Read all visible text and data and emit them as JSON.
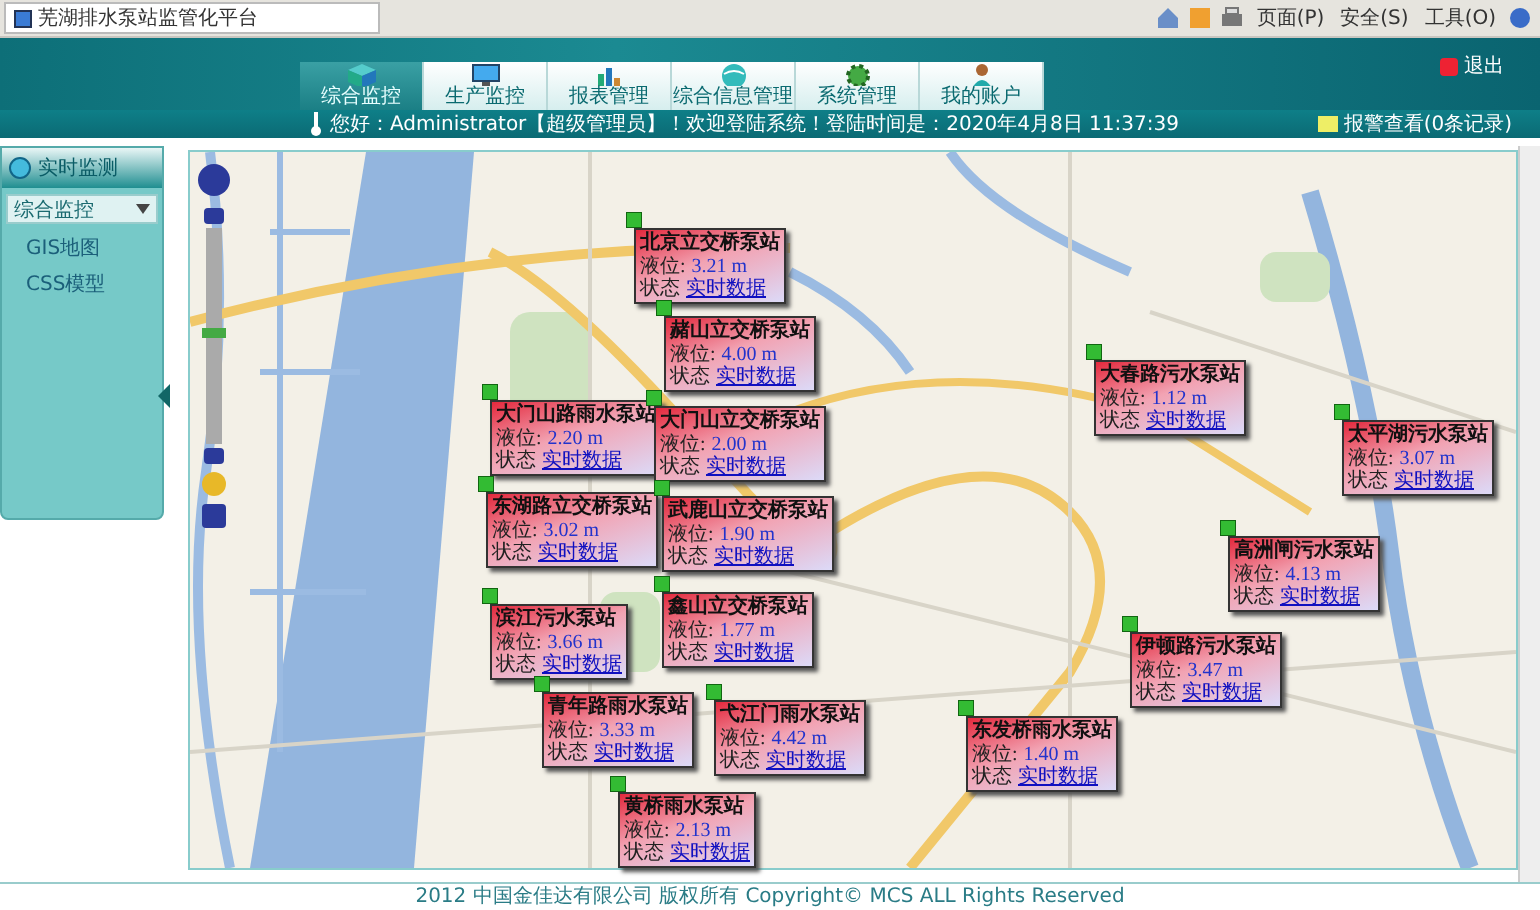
{
  "browser": {
    "tab_title": "芜湖排水泵站监管化平台",
    "toolbar": [
      "页面(P)",
      "安全(S)",
      "工具(O)"
    ]
  },
  "header": {
    "tabs": [
      {
        "label": "综合监控",
        "selected": true
      },
      {
        "label": "生产监控",
        "selected": false
      },
      {
        "label": "报表管理",
        "selected": false
      },
      {
        "label": "综合信息管理",
        "selected": false
      },
      {
        "label": "系统管理",
        "selected": false
      },
      {
        "label": "我的账户",
        "selected": false
      }
    ],
    "logout": "退出"
  },
  "info_bar": {
    "welcome": "您好：Administrator【超级管理员】！欢迎登陆系统！登陆时间是：2020年4月8日 11:37:39",
    "alarm": "报警查看(0条记录)"
  },
  "sidebar": {
    "title": "实时监测",
    "dropdown": "综合监控",
    "items": [
      "GIS地图",
      "CSS模型"
    ]
  },
  "stations": [
    {
      "name": "北京立交桥泵站",
      "level_label": "液位:",
      "level_value": "3.21 m",
      "status_label": "状态",
      "status_link": "实时数据"
    },
    {
      "name": "赭山立交桥泵站",
      "level_label": "液位:",
      "level_value": "4.00 m",
      "status_label": "状态",
      "status_link": "实时数据"
    },
    {
      "name": "大春路污水泵站",
      "level_label": "液位:",
      "level_value": "1.12 m",
      "status_label": "状态",
      "status_link": "实时数据"
    },
    {
      "name": "大门山路雨水泵站",
      "level_label": "液位:",
      "level_value": "2.20 m",
      "status_label": "状态",
      "status_link": "实时数据"
    },
    {
      "name": "大门山立交桥泵站",
      "level_label": "液位:",
      "level_value": "2.00 m",
      "status_label": "状态",
      "status_link": "实时数据"
    },
    {
      "name": "太平湖污水泵站",
      "level_label": "液位:",
      "level_value": "3.07 m",
      "status_label": "状态",
      "status_link": "实时数据"
    },
    {
      "name": "东湖路立交桥泵站",
      "level_label": "液位:",
      "level_value": "3.02 m",
      "status_label": "状态",
      "status_link": "实时数据"
    },
    {
      "name": "武鹿山立交桥泵站",
      "level_label": "液位:",
      "level_value": "1.90 m",
      "status_label": "状态",
      "status_link": "实时数据"
    },
    {
      "name": "高洲闸污水泵站",
      "level_label": "液位:",
      "level_value": "4.13 m",
      "status_label": "状态",
      "status_link": "实时数据"
    },
    {
      "name": "鑫山立交桥泵站",
      "level_label": "液位:",
      "level_value": "1.77 m",
      "status_label": "状态",
      "status_link": "实时数据"
    },
    {
      "name": "滨江污水泵站",
      "level_label": "液位:",
      "level_value": "3.66 m",
      "status_label": "状态",
      "status_link": "实时数据"
    },
    {
      "name": "伊顿路污水泵站",
      "level_label": "液位:",
      "level_value": "3.47 m",
      "status_label": "状态",
      "status_link": "实时数据"
    },
    {
      "name": "青年路雨水泵站",
      "level_label": "液位:",
      "level_value": "3.33 m",
      "status_label": "状态",
      "status_link": "实时数据"
    },
    {
      "name": "弋江门雨水泵站",
      "level_label": "液位:",
      "level_value": "4.42 m",
      "status_label": "状态",
      "status_link": "实时数据"
    },
    {
      "name": "东发桥雨水泵站",
      "level_label": "液位:",
      "level_value": "1.40 m",
      "status_label": "状态",
      "status_link": "实时数据"
    },
    {
      "name": "黄桥雨水泵站",
      "level_label": "液位:",
      "level_value": "2.13 m",
      "status_label": "状态",
      "status_link": "实时数据"
    }
  ],
  "footer": "2012 中国金佳达有限公司 版权所有 Copyright© MCS ALL Rights Reserved"
}
